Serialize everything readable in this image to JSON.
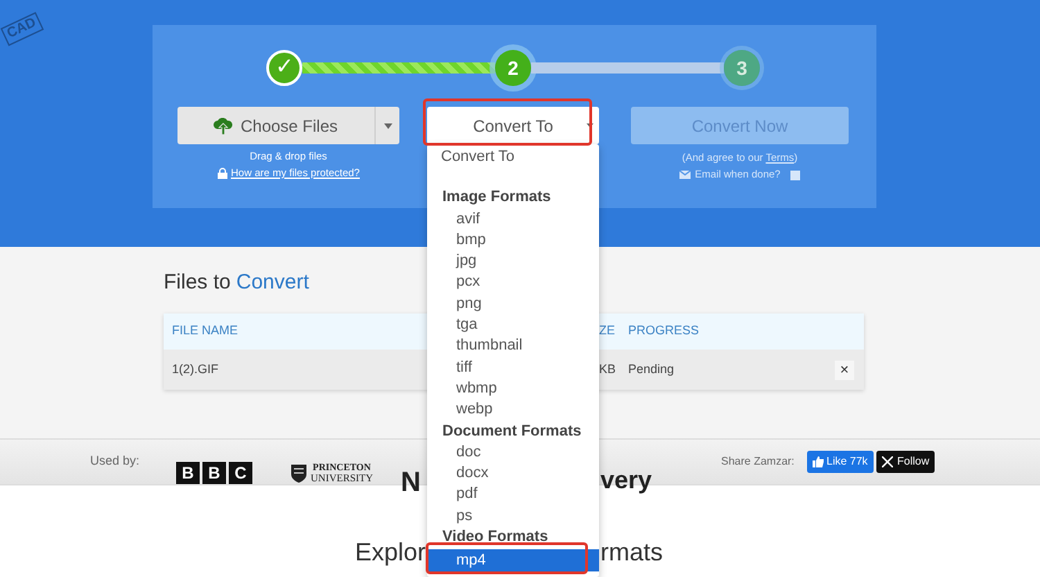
{
  "background": {
    "doodle_text": "CAD"
  },
  "steps": [
    {
      "label": "✓",
      "done": true,
      "selected": false
    },
    {
      "label": "2",
      "done": false,
      "selected": true
    },
    {
      "label": "3",
      "done": false,
      "selected": false
    }
  ],
  "choose_files": {
    "label": "Choose Files",
    "hint": "Drag & drop files",
    "protect_link": "How are my files protected?"
  },
  "convert_to": {
    "label": "Convert To",
    "annotated": true
  },
  "convert_now": {
    "label": "Convert Now",
    "disabled": true,
    "terms_prefix": "(And agree to our ",
    "terms_link": "Terms",
    "terms_suffix": ")",
    "email_label": "Email when done?",
    "email_checked": false
  },
  "files": {
    "title": "Files to",
    "title_accent": "Convert"
  },
  "table": {
    "columns": [
      "FILE NAME",
      "ZE",
      "PROGRESS"
    ],
    "rows": [
      {
        "cells": [
          "1(2).GIF",
          "KB",
          "Pending"
        ],
        "remove": "×"
      }
    ]
  },
  "used_by": {
    "label": "Used by:",
    "logos": [
      {
        "kind": "bbc",
        "letters": [
          "B",
          "B",
          "C"
        ]
      },
      {
        "kind": "princeton",
        "lines": [
          "PRINCETON",
          "UNIVERSITY"
        ]
      },
      {
        "kind": "partial_left",
        "text": "N"
      },
      {
        "kind": "partial_right",
        "text": "very"
      }
    ]
  },
  "share": {
    "label": "Share Zamzar:",
    "like": "Like 77k",
    "follow": "Follow"
  },
  "explore": {
    "left": "Explor",
    "right": "rmats"
  },
  "dropdown": {
    "items": [
      {
        "kind": "option",
        "label": "Convert To",
        "selected": false,
        "annotated": false
      },
      {
        "kind": "group",
        "label": "Image Formats"
      },
      {
        "kind": "format",
        "label": "avif",
        "selected": false,
        "annotated": false
      },
      {
        "kind": "format",
        "label": "bmp",
        "selected": false,
        "annotated": false
      },
      {
        "kind": "format",
        "label": "jpg",
        "selected": false,
        "annotated": false
      },
      {
        "kind": "format",
        "label": "pcx",
        "selected": false,
        "annotated": false
      },
      {
        "kind": "format",
        "label": "png",
        "selected": false,
        "annotated": false
      },
      {
        "kind": "format",
        "label": "tga",
        "selected": false,
        "annotated": false
      },
      {
        "kind": "format",
        "label": "thumbnail",
        "selected": false,
        "annotated": false
      },
      {
        "kind": "format",
        "label": "tiff",
        "selected": false,
        "annotated": false
      },
      {
        "kind": "format",
        "label": "wbmp",
        "selected": false,
        "annotated": false
      },
      {
        "kind": "format",
        "label": "webp",
        "selected": false,
        "annotated": false
      },
      {
        "kind": "group",
        "label": "Document Formats"
      },
      {
        "kind": "format",
        "label": "doc",
        "selected": false,
        "annotated": false
      },
      {
        "kind": "format",
        "label": "docx",
        "selected": false,
        "annotated": false
      },
      {
        "kind": "format",
        "label": "pdf",
        "selected": false,
        "annotated": false
      },
      {
        "kind": "format",
        "label": "ps",
        "selected": false,
        "annotated": false
      },
      {
        "kind": "group",
        "label": "Video Formats"
      },
      {
        "kind": "format",
        "label": "mp4",
        "selected": true,
        "annotated": true
      }
    ]
  }
}
